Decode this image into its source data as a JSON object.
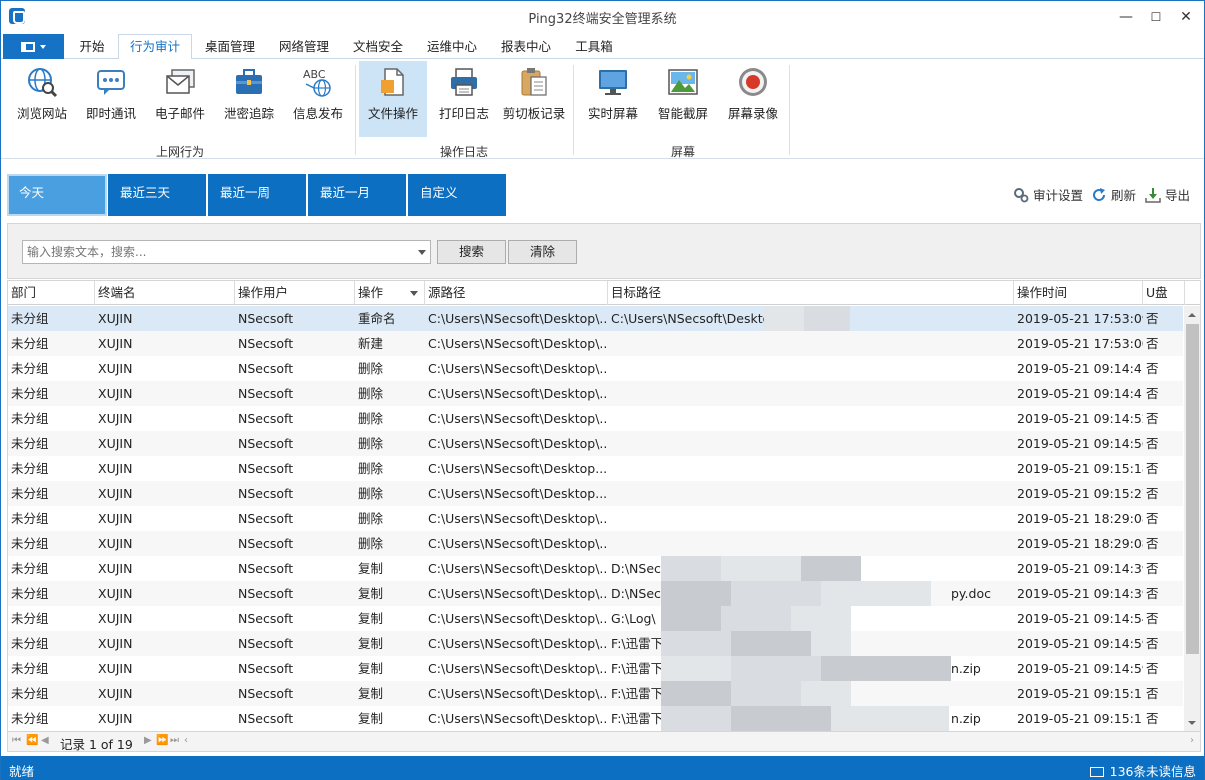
{
  "window": {
    "title": "Ping32终端安全管理系统",
    "minimize": "—",
    "maximize": "☐",
    "close": "✕"
  },
  "menu": {
    "tabs": [
      "开始",
      "行为审计",
      "桌面管理",
      "网络管理",
      "文档安全",
      "运维中心",
      "报表中心",
      "工具箱"
    ],
    "active_index": 1
  },
  "ribbon": {
    "groups": [
      {
        "label": "上网行为",
        "buttons": [
          "浏览网站",
          "即时通讯",
          "电子邮件",
          "泄密追踪",
          "信息发布"
        ]
      },
      {
        "label": "操作日志",
        "buttons": [
          "文件操作",
          "打印日志",
          "剪切板记录"
        ]
      },
      {
        "label": "屏幕",
        "buttons": [
          "实时屏幕",
          "智能截屏",
          "屏幕录像"
        ]
      }
    ],
    "abc_text": "ABC",
    "active_button": "文件操作"
  },
  "date_tabs": [
    "今天",
    "最近三天",
    "最近一周",
    "最近一月",
    "自定义"
  ],
  "tools": {
    "settings": "审计设置",
    "refresh": "刷新",
    "export": "导出"
  },
  "search": {
    "placeholder": "输入搜索文本，搜索...",
    "search_button": "搜索",
    "clear_button": "清除"
  },
  "table": {
    "columns": [
      "部门",
      "终端名",
      "操作用户",
      "操作",
      "源路径",
      "目标路径",
      "操作时间",
      "U盘"
    ],
    "rows": [
      [
        "未分组",
        "XUJIN",
        "NSecsoft",
        "重命名",
        "C:\\Users\\NSecsoft\\Desktop\\...",
        "C:\\Users\\NSecsoft\\Deskto",
        "2019-05-21 17:53:09",
        "否"
      ],
      [
        "未分组",
        "XUJIN",
        "NSecsoft",
        "新建",
        "C:\\Users\\NSecsoft\\Desktop\\...",
        "",
        "2019-05-21 17:53:00",
        "否"
      ],
      [
        "未分组",
        "XUJIN",
        "NSecsoft",
        "删除",
        "C:\\Users\\NSecsoft\\Desktop\\...",
        "",
        "2019-05-21 09:14:41",
        "否"
      ],
      [
        "未分组",
        "XUJIN",
        "NSecsoft",
        "删除",
        "C:\\Users\\NSecsoft\\Desktop\\...",
        "",
        "2019-05-21 09:14:41",
        "否"
      ],
      [
        "未分组",
        "XUJIN",
        "NSecsoft",
        "删除",
        "C:\\Users\\NSecsoft\\Desktop\\...",
        "",
        "2019-05-21 09:14:52",
        "否"
      ],
      [
        "未分组",
        "XUJIN",
        "NSecsoft",
        "删除",
        "C:\\Users\\NSecsoft\\Desktop\\...",
        "",
        "2019-05-21 09:14:56",
        "否"
      ],
      [
        "未分组",
        "XUJIN",
        "NSecsoft",
        "删除",
        "C:\\Users\\NSecsoft\\Desktop...",
        "",
        "2019-05-21 09:15:18",
        "否"
      ],
      [
        "未分组",
        "XUJIN",
        "NSecsoft",
        "删除",
        "C:\\Users\\NSecsoft\\Desktop...",
        "",
        "2019-05-21 09:15:27",
        "否"
      ],
      [
        "未分组",
        "XUJIN",
        "NSecsoft",
        "删除",
        "C:\\Users\\NSecsoft\\Desktop\\...",
        "",
        "2019-05-21 18:29:08",
        "否"
      ],
      [
        "未分组",
        "XUJIN",
        "NSecsoft",
        "删除",
        "C:\\Users\\NSecsoft\\Desktop\\...",
        "",
        "2019-05-21 18:29:08",
        "否"
      ],
      [
        "未分组",
        "XUJIN",
        "NSecsoft",
        "复制",
        "C:\\Users\\NSecsoft\\Desktop\\...",
        "D:\\NSec",
        "2019-05-21 09:14:39",
        "否"
      ],
      [
        "未分组",
        "XUJIN",
        "NSecsoft",
        "复制",
        "C:\\Users\\NSecsoft\\Desktop\\...",
        "D:\\NSec",
        "2019-05-21 09:14:39",
        "否"
      ],
      [
        "未分组",
        "XUJIN",
        "NSecsoft",
        "复制",
        "C:\\Users\\NSecsoft\\Desktop\\...",
        "G:\\Log\\",
        "2019-05-21 09:14:54",
        "否"
      ],
      [
        "未分组",
        "XUJIN",
        "NSecsoft",
        "复制",
        "C:\\Users\\NSecsoft\\Desktop\\...",
        "F:\\迅雷下",
        "2019-05-21 09:14:59",
        "否"
      ],
      [
        "未分组",
        "XUJIN",
        "NSecsoft",
        "复制",
        "C:\\Users\\NSecsoft\\Desktop\\...",
        "F:\\迅雷下",
        "2019-05-21 09:14:59",
        "否"
      ],
      [
        "未分组",
        "XUJIN",
        "NSecsoft",
        "复制",
        "C:\\Users\\NSecsoft\\Desktop\\...",
        "F:\\迅雷下",
        "2019-05-21 09:15:11",
        "否"
      ],
      [
        "未分组",
        "XUJIN",
        "NSecsoft",
        "复制",
        "C:\\Users\\NSecsoft\\Desktop\\...",
        "F:\\迅雷下",
        "2019-05-21 09:15:11",
        "否"
      ]
    ],
    "target_suffixes": {
      "11": "py.doc",
      "14": "n.zip",
      "16": "n.zip"
    }
  },
  "pager": {
    "text": "记录 1 of 19"
  },
  "status": {
    "left": "就绪",
    "right": "136条未读信息"
  },
  "colors": {
    "accent": "#0d6fc2",
    "selected_row": "#dbe9f6",
    "active_ribbon": "#cde4f7"
  }
}
